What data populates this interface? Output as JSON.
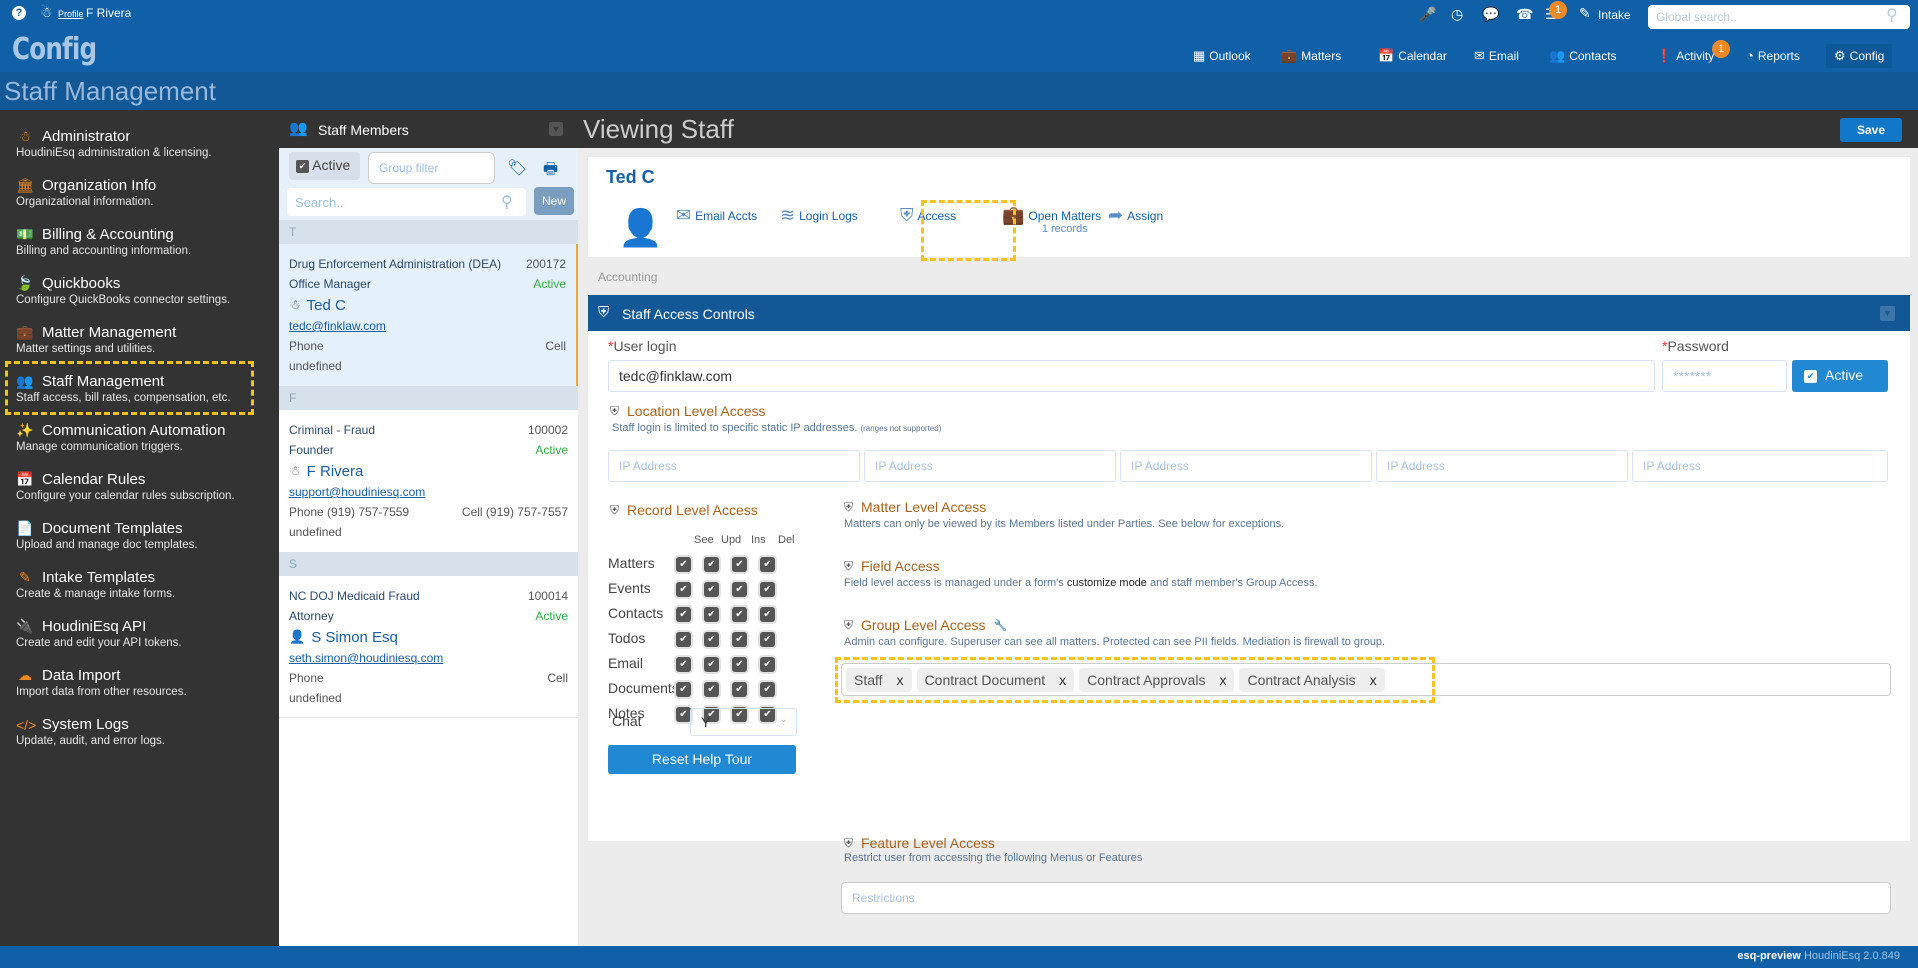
{
  "topbar": {
    "profile_link": "Profile",
    "user_name": "F Rivera",
    "brand": "Config",
    "intake_label": "Intake",
    "global_search_placeholder": "Global search..",
    "notification_count": "1",
    "activity_count": "1",
    "nav": [
      {
        "label": "Outlook",
        "icon": "grid-icon"
      },
      {
        "label": "Matters",
        "icon": "briefcase-icon"
      },
      {
        "label": "Calendar",
        "icon": "calendar-icon"
      },
      {
        "label": "Email",
        "icon": "envelope-icon"
      },
      {
        "label": "Contacts",
        "icon": "users-icon"
      },
      {
        "label": "Activity",
        "icon": "exclamation-icon"
      },
      {
        "label": "Reports",
        "icon": "pie-chart-icon"
      },
      {
        "label": "Config",
        "icon": "gears-icon"
      }
    ]
  },
  "page_title": "Staff Management",
  "sidebar": {
    "items": [
      {
        "title": "Administrator",
        "desc": "HoudiniEsq administration & licensing.",
        "icon": "user-secret-icon"
      },
      {
        "title": "Organization Info",
        "desc": "Organizational information.",
        "icon": "institution-icon"
      },
      {
        "title": "Billing & Accounting",
        "desc": "Billing and accounting information.",
        "icon": "money-icon"
      },
      {
        "title": "Quickbooks",
        "desc": "Configure QuickBooks connector settings.",
        "icon": "leaf-icon"
      },
      {
        "title": "Matter Management",
        "desc": "Matter settings and utilities.",
        "icon": "briefcase-icon"
      },
      {
        "title": "Staff Management",
        "desc": "Staff access, bill rates, compensation, etc.",
        "icon": "users-icon"
      },
      {
        "title": "Communication Automation",
        "desc": "Manage communication triggers.",
        "icon": "magic-wand-icon"
      },
      {
        "title": "Calendar Rules",
        "desc": "Configure your calendar rules subscription.",
        "icon": "calendar-icon"
      },
      {
        "title": "Document Templates",
        "desc": "Upload and manage doc templates.",
        "icon": "file-icon"
      },
      {
        "title": "Intake Templates",
        "desc": "Create & manage intake forms.",
        "icon": "edit-icon"
      },
      {
        "title": "HoudiniEsq API",
        "desc": "Create and edit your API tokens.",
        "icon": "plug-icon"
      },
      {
        "title": "Data Import",
        "desc": "Import data from other resources.",
        "icon": "cloud-upload-icon"
      },
      {
        "title": "System Logs",
        "desc": "Update, audit, and error logs.",
        "icon": "code-icon"
      }
    ]
  },
  "staff_list": {
    "title": "Staff Members",
    "active_label": "Active",
    "group_filter_placeholder": "Group filter",
    "search_placeholder": "Search..",
    "new_label": "New",
    "groups": [
      {
        "letter": "T",
        "members": [
          {
            "org": "Drug Enforcement Administration (DEA)",
            "id": "200172",
            "role": "Office Manager",
            "status": "Active",
            "name": "Ted C",
            "email": "tedc@finklaw.com",
            "phone": "Phone",
            "cell": "Cell",
            "extra": "undefined"
          }
        ]
      },
      {
        "letter": "F",
        "members": [
          {
            "org": "Criminal - Fraud",
            "id": "100002",
            "role": "Founder",
            "status": "Active",
            "name": "F Rivera",
            "email": "support@houdiniesq.com",
            "phone": "Phone (919) 757-7559",
            "cell": "Cell (919) 757-7557",
            "extra": "undefined"
          }
        ]
      },
      {
        "letter": "S",
        "members": [
          {
            "org": "NC DOJ Medicaid Fraud",
            "id": "100014",
            "role": "Attorney",
            "status": "Active",
            "name": "S Simon Esq",
            "email": "seth.simon@houdiniesq.com",
            "phone": "Phone",
            "cell": "Cell",
            "extra": "undefined"
          }
        ]
      }
    ]
  },
  "main": {
    "title": "Viewing Staff",
    "save_label": "Save",
    "staff_name": "Ted C",
    "tabs": [
      {
        "label": "Email Accts",
        "icon": "envelope-icon"
      },
      {
        "label": "Login Logs",
        "icon": "wifi-icon"
      },
      {
        "label": "Access",
        "icon": "shield-icon"
      },
      {
        "label": "Open Matters",
        "sub": "1 records",
        "icon": "briefcase-icon"
      },
      {
        "label": "Assign",
        "icon": "share-icon"
      }
    ],
    "accounting_label": "Accounting",
    "access": {
      "title": "Staff Access Controls",
      "user_login_label": "User login",
      "user_login_value": "tedc@finklaw.com",
      "password_label": "Password",
      "password_placeholder": "*******",
      "active_label": "Active",
      "location": {
        "title": "Location Level Access",
        "desc": "Staff login is limited to specific static IP addresses.",
        "note": "(ranges not supported)",
        "ip_placeholder": "IP Address"
      },
      "record": {
        "title": "Record Level Access",
        "columns": [
          "See",
          "Upd",
          "Ins",
          "Del"
        ],
        "rows": [
          {
            "label": "Matters",
            "checked": [
              true,
              true,
              true,
              true
            ]
          },
          {
            "label": "Events",
            "checked": [
              true,
              true,
              true,
              true
            ]
          },
          {
            "label": "Contacts",
            "checked": [
              true,
              true,
              true,
              true
            ]
          },
          {
            "label": "Todos",
            "checked": [
              true,
              true,
              true,
              true
            ]
          },
          {
            "label": "Email",
            "checked": [
              true,
              true,
              true,
              true
            ]
          },
          {
            "label": "Documents",
            "checked": [
              true,
              true,
              true,
              true
            ]
          },
          {
            "label": "Notes",
            "checked": [
              true,
              true,
              true,
              true
            ]
          }
        ],
        "chat_label": "Chat",
        "chat_value": "Y",
        "reset_label": "Reset Help Tour"
      },
      "matter": {
        "title": "Matter Level Access",
        "desc": "Matters can only be viewed by its Members listed under Parties. See below for exceptions."
      },
      "field": {
        "title": "Field Access",
        "desc_pre": "Field level access is managed under a form's ",
        "desc_mid": "customize mode",
        "desc_post": " and staff member's Group Access."
      },
      "group": {
        "title": "Group Level Access",
        "desc": "Admin can configure. Superuser can see all matters. Protected can see PII fields. Mediation is firewall to group.",
        "tags": [
          "Staff",
          "Contract Document",
          "Contract Approvals",
          "Contract Analysis"
        ],
        "remove_label": "x"
      },
      "feature": {
        "title": "Feature Level Access",
        "desc": "Restrict user from accessing the following Menus or Features",
        "placeholder": "Restrictions"
      }
    }
  },
  "footer": {
    "env": "esq-preview",
    "version": "HoudiniEsq 2.0.849"
  }
}
